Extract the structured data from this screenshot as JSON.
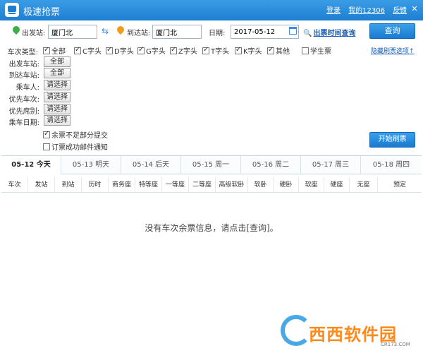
{
  "app": {
    "title": "极速抢票"
  },
  "titlebar": {
    "login": "登录",
    "my12306": "我的12306",
    "feedback": "反馈"
  },
  "query": {
    "from_label": "出发站:",
    "from_value": "厦门北",
    "to_label": "到达站:",
    "to_value": "厦门北",
    "date_label": "日期:",
    "date_value": "2017-05-12",
    "time_link": "出票时间查询",
    "query_button": "查询"
  },
  "filters": {
    "train_type_label": "车次类型:",
    "train_types": [
      {
        "label": "全部",
        "checked": true
      },
      {
        "label": "C字头",
        "checked": true
      },
      {
        "label": "D字头",
        "checked": true
      },
      {
        "label": "G字头",
        "checked": true
      },
      {
        "label": "Z字头",
        "checked": true
      },
      {
        "label": "T字头",
        "checked": true
      },
      {
        "label": "K字头",
        "checked": true
      },
      {
        "label": "其他",
        "checked": true
      },
      {
        "label": "学生票",
        "checked": false
      }
    ],
    "hide_link": "隐藏刷票选项↑",
    "from_station_label": "出发车站:",
    "from_station_btn": "全部",
    "to_station_label": "到达车站:",
    "to_station_btn": "全部",
    "passenger_label": "乘车人:",
    "passenger_btn": "请选择",
    "priority_train_label": "优先车次:",
    "priority_train_btn": "请选择",
    "priority_seat_label": "优先席别:",
    "priority_seat_btn": "请选择",
    "travel_date_label": "乘车日期:",
    "travel_date_btn": "请选择",
    "partial_submit": {
      "label": "余票不足部分提交",
      "checked": true
    },
    "email_notify": {
      "label": "订票成功邮件通知",
      "checked": false
    },
    "start_button": "开始刷票"
  },
  "date_tabs": [
    "05-12 今天",
    "05-13 明天",
    "05-14 后天",
    "05-15 周一",
    "05-16 周二",
    "05-17 周三",
    "05-18 周四"
  ],
  "columns": [
    "车次",
    "发站",
    "到站",
    "历时",
    "商务座",
    "特等座",
    "一等座",
    "二等座",
    "高级软卧",
    "软卧",
    "硬卧",
    "软座",
    "硬座",
    "无座",
    "预定"
  ],
  "empty_message": "没有车次余票信息，请点击[查询]。",
  "watermark": {
    "logo_text": "西西软件园",
    "url": "CR173.COM"
  }
}
